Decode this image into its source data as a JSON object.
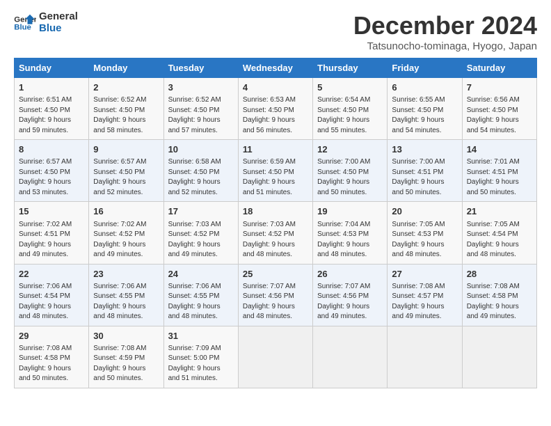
{
  "logo": {
    "line1": "General",
    "line2": "Blue"
  },
  "title": "December 2024",
  "subtitle": "Tatsunocho-tominaga, Hyogo, Japan",
  "weekdays": [
    "Sunday",
    "Monday",
    "Tuesday",
    "Wednesday",
    "Thursday",
    "Friday",
    "Saturday"
  ],
  "weeks": [
    [
      {
        "day": "1",
        "info": "Sunrise: 6:51 AM\nSunset: 4:50 PM\nDaylight: 9 hours\nand 59 minutes."
      },
      {
        "day": "2",
        "info": "Sunrise: 6:52 AM\nSunset: 4:50 PM\nDaylight: 9 hours\nand 58 minutes."
      },
      {
        "day": "3",
        "info": "Sunrise: 6:52 AM\nSunset: 4:50 PM\nDaylight: 9 hours\nand 57 minutes."
      },
      {
        "day": "4",
        "info": "Sunrise: 6:53 AM\nSunset: 4:50 PM\nDaylight: 9 hours\nand 56 minutes."
      },
      {
        "day": "5",
        "info": "Sunrise: 6:54 AM\nSunset: 4:50 PM\nDaylight: 9 hours\nand 55 minutes."
      },
      {
        "day": "6",
        "info": "Sunrise: 6:55 AM\nSunset: 4:50 PM\nDaylight: 9 hours\nand 54 minutes."
      },
      {
        "day": "7",
        "info": "Sunrise: 6:56 AM\nSunset: 4:50 PM\nDaylight: 9 hours\nand 54 minutes."
      }
    ],
    [
      {
        "day": "8",
        "info": "Sunrise: 6:57 AM\nSunset: 4:50 PM\nDaylight: 9 hours\nand 53 minutes."
      },
      {
        "day": "9",
        "info": "Sunrise: 6:57 AM\nSunset: 4:50 PM\nDaylight: 9 hours\nand 52 minutes."
      },
      {
        "day": "10",
        "info": "Sunrise: 6:58 AM\nSunset: 4:50 PM\nDaylight: 9 hours\nand 52 minutes."
      },
      {
        "day": "11",
        "info": "Sunrise: 6:59 AM\nSunset: 4:50 PM\nDaylight: 9 hours\nand 51 minutes."
      },
      {
        "day": "12",
        "info": "Sunrise: 7:00 AM\nSunset: 4:50 PM\nDaylight: 9 hours\nand 50 minutes."
      },
      {
        "day": "13",
        "info": "Sunrise: 7:00 AM\nSunset: 4:51 PM\nDaylight: 9 hours\nand 50 minutes."
      },
      {
        "day": "14",
        "info": "Sunrise: 7:01 AM\nSunset: 4:51 PM\nDaylight: 9 hours\nand 50 minutes."
      }
    ],
    [
      {
        "day": "15",
        "info": "Sunrise: 7:02 AM\nSunset: 4:51 PM\nDaylight: 9 hours\nand 49 minutes."
      },
      {
        "day": "16",
        "info": "Sunrise: 7:02 AM\nSunset: 4:52 PM\nDaylight: 9 hours\nand 49 minutes."
      },
      {
        "day": "17",
        "info": "Sunrise: 7:03 AM\nSunset: 4:52 PM\nDaylight: 9 hours\nand 49 minutes."
      },
      {
        "day": "18",
        "info": "Sunrise: 7:03 AM\nSunset: 4:52 PM\nDaylight: 9 hours\nand 48 minutes."
      },
      {
        "day": "19",
        "info": "Sunrise: 7:04 AM\nSunset: 4:53 PM\nDaylight: 9 hours\nand 48 minutes."
      },
      {
        "day": "20",
        "info": "Sunrise: 7:05 AM\nSunset: 4:53 PM\nDaylight: 9 hours\nand 48 minutes."
      },
      {
        "day": "21",
        "info": "Sunrise: 7:05 AM\nSunset: 4:54 PM\nDaylight: 9 hours\nand 48 minutes."
      }
    ],
    [
      {
        "day": "22",
        "info": "Sunrise: 7:06 AM\nSunset: 4:54 PM\nDaylight: 9 hours\nand 48 minutes."
      },
      {
        "day": "23",
        "info": "Sunrise: 7:06 AM\nSunset: 4:55 PM\nDaylight: 9 hours\nand 48 minutes."
      },
      {
        "day": "24",
        "info": "Sunrise: 7:06 AM\nSunset: 4:55 PM\nDaylight: 9 hours\nand 48 minutes."
      },
      {
        "day": "25",
        "info": "Sunrise: 7:07 AM\nSunset: 4:56 PM\nDaylight: 9 hours\nand 48 minutes."
      },
      {
        "day": "26",
        "info": "Sunrise: 7:07 AM\nSunset: 4:56 PM\nDaylight: 9 hours\nand 49 minutes."
      },
      {
        "day": "27",
        "info": "Sunrise: 7:08 AM\nSunset: 4:57 PM\nDaylight: 9 hours\nand 49 minutes."
      },
      {
        "day": "28",
        "info": "Sunrise: 7:08 AM\nSunset: 4:58 PM\nDaylight: 9 hours\nand 49 minutes."
      }
    ],
    [
      {
        "day": "29",
        "info": "Sunrise: 7:08 AM\nSunset: 4:58 PM\nDaylight: 9 hours\nand 50 minutes."
      },
      {
        "day": "30",
        "info": "Sunrise: 7:08 AM\nSunset: 4:59 PM\nDaylight: 9 hours\nand 50 minutes."
      },
      {
        "day": "31",
        "info": "Sunrise: 7:09 AM\nSunset: 5:00 PM\nDaylight: 9 hours\nand 51 minutes."
      },
      null,
      null,
      null,
      null
    ]
  ]
}
